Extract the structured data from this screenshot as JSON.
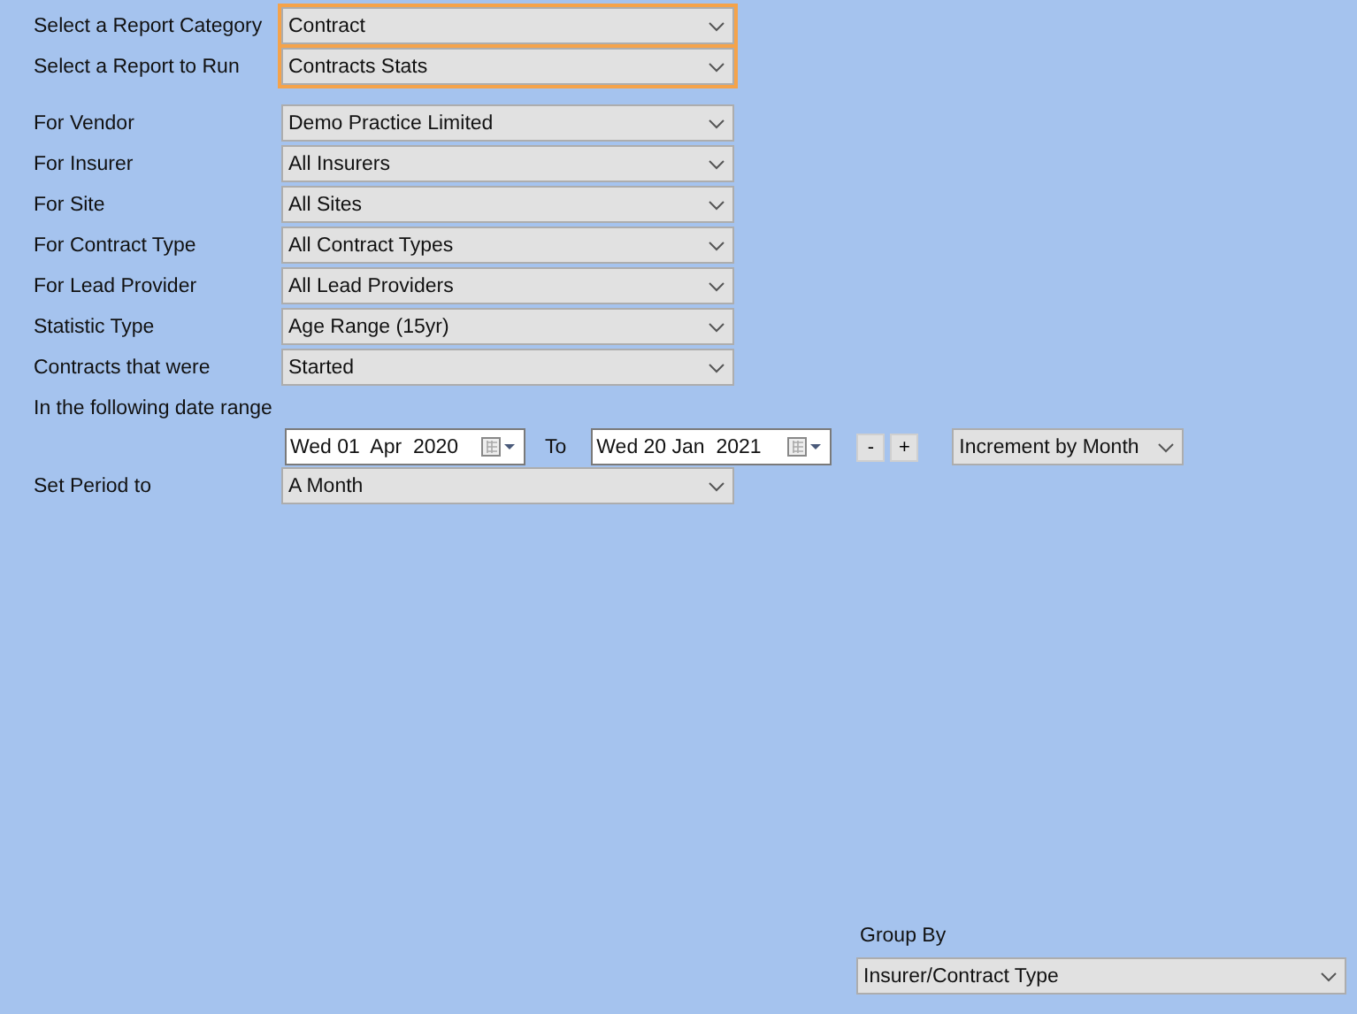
{
  "report_selectors": [
    {
      "label": "Select a Report Category",
      "value": "Contract",
      "highlighted": true
    },
    {
      "label": "Select a Report to Run",
      "value": "Contracts Stats",
      "highlighted": true
    }
  ],
  "filters": [
    {
      "label": "For Vendor",
      "value": "Demo Practice Limited",
      "highlighted": false
    },
    {
      "label": "For Insurer",
      "value": "All Insurers",
      "highlighted": false
    },
    {
      "label": "For Site",
      "value": "All Sites",
      "highlighted": false
    },
    {
      "label": "For Contract Type",
      "value": "All Contract Types",
      "highlighted": false
    },
    {
      "label": "For Lead Provider",
      "value": "All Lead Providers",
      "highlighted": false
    },
    {
      "label": "Statistic Type",
      "value": "Age Range (15yr)",
      "highlighted": false
    },
    {
      "label": "Contracts that were",
      "value": "Started",
      "highlighted": false
    }
  ],
  "date_range": {
    "label": "In the following date range",
    "from": "Wed 01  Apr  2020",
    "to_label": "To",
    "to": "Wed 20 Jan  2021",
    "buttons": [
      "-",
      "+"
    ],
    "increment": "Increment by Month"
  },
  "period": {
    "label": "Set Period to",
    "value": "A Month"
  },
  "group_by": {
    "label": "Group By",
    "value": "Insurer/Contract Type"
  }
}
